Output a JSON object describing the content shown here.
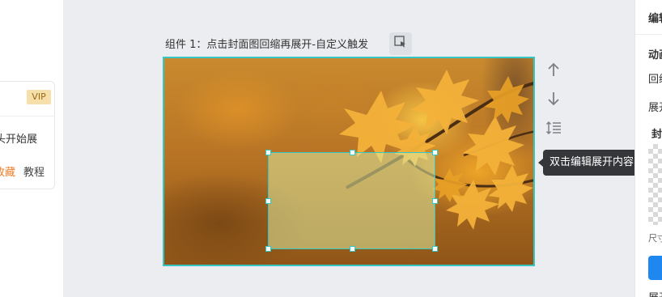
{
  "left_card": {
    "vip_badge": "VIP",
    "text_1": "从头开始展",
    "text_2": "收藏",
    "text_3": "教程"
  },
  "component": {
    "title": "组件 1：点击封面图回缩再展开-自定义触发",
    "icon": "cursor-select-icon"
  },
  "side_tools": [
    "arrow-up-icon",
    "arrow-down-icon",
    "line-spacing-icon"
  ],
  "tooltip": {
    "text": "双击编辑展开内容"
  },
  "right_panel": {
    "header": "编辑",
    "section": "动画",
    "item_1": "回缩",
    "item_2": "展开",
    "item_3": "封面",
    "size_label": "尺寸",
    "bottom_label": "展开"
  },
  "colors": {
    "accent": "#35c6c6",
    "primary_button": "#1e87f0",
    "tooltip_bg": "#34363a",
    "vip_bg": "#f7dfa9",
    "favorite_text": "#ef7d29"
  }
}
